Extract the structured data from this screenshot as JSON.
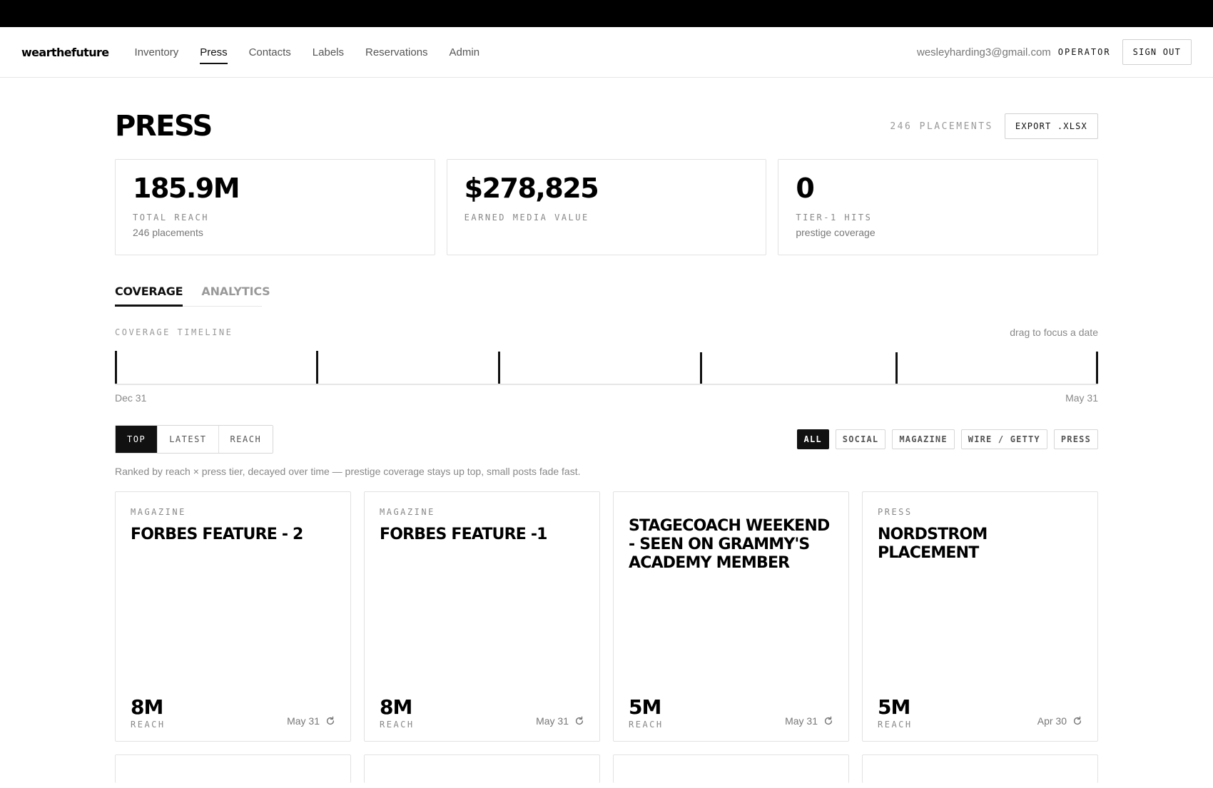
{
  "nav": {
    "logo": "wearthefuture",
    "links": [
      "Inventory",
      "Press",
      "Contacts",
      "Labels",
      "Reservations",
      "Admin"
    ],
    "active": "Press",
    "user_email": "wesleyharding3@gmail.com",
    "user_role": "OPERATOR",
    "sign_out_label": "SIGN OUT"
  },
  "header": {
    "title": "PRESS",
    "placements_count": "246 PLACEMENTS",
    "export_label": "EXPORT .XLSX"
  },
  "stats": [
    {
      "value": "185.9M",
      "label": "TOTAL REACH",
      "sub": "246 placements"
    },
    {
      "value": "$278,825",
      "label": "EARNED MEDIA VALUE",
      "sub": ""
    },
    {
      "value": "0",
      "label": "TIER-1 HITS",
      "sub": "prestige coverage"
    }
  ],
  "tabs": {
    "coverage": "COVERAGE",
    "analytics": "ANALYTICS",
    "active": "coverage"
  },
  "timeline": {
    "label": "COVERAGE TIMELINE",
    "hint": "drag to focus a date",
    "start": "Dec 31",
    "end": "May 31"
  },
  "sort": {
    "options": [
      "TOP",
      "LATEST",
      "REACH"
    ],
    "active": "TOP"
  },
  "filters": {
    "options": [
      "ALL",
      "SOCIAL",
      "MAGAZINE",
      "WIRE / GETTY",
      "PRESS"
    ],
    "active": "ALL"
  },
  "ranking_note": "Ranked by reach × press tier, decayed over time — prestige coverage stays up top, small posts fade fast.",
  "cards": [
    {
      "category": "MAGAZINE",
      "title": "FORBES FEATURE - 2",
      "reach": "8M",
      "reach_label": "REACH",
      "date": "May 31"
    },
    {
      "category": "MAGAZINE",
      "title": "FORBES FEATURE -1",
      "reach": "8M",
      "reach_label": "REACH",
      "date": "May 31"
    },
    {
      "category": "",
      "title": "STAGECOACH WEEKEND - SEEN ON GRAMMY'S ACADEMY MEMBER",
      "reach": "5M",
      "reach_label": "REACH",
      "date": "May 31"
    },
    {
      "category": "PRESS",
      "title": "NORDSTROM PLACEMENT",
      "reach": "5M",
      "reach_label": "REACH",
      "date": "Apr 30"
    }
  ],
  "colors": {
    "accent": "#111111",
    "muted": "#888888",
    "border": "#e2e2e2"
  },
  "icons": {
    "card_date": "refresh-icon"
  }
}
